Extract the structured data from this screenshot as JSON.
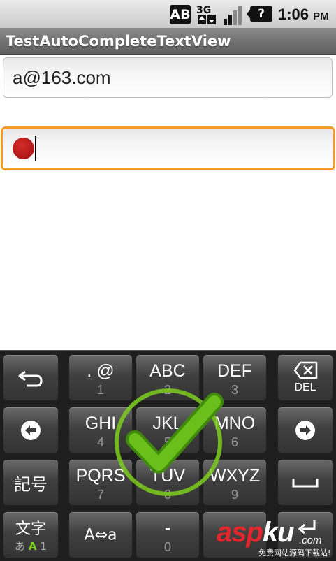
{
  "status_bar": {
    "ab_label": "AB",
    "network_label": "3G",
    "question_label": "?",
    "time": "1:06",
    "ampm": "PM"
  },
  "app": {
    "title": "TestAutoCompleteTextView"
  },
  "fields": {
    "email_value": "a@163.com",
    "focused_value": ""
  },
  "keyboard": {
    "back": {
      "icon": "return-arrow-icon"
    },
    "k1": {
      "main": ". @",
      "sub": "1"
    },
    "k2": {
      "main": "ABC",
      "sub": "2"
    },
    "k3": {
      "main": "DEF",
      "sub": "3"
    },
    "del": {
      "label": "DEL",
      "icon": "backspace-icon"
    },
    "left": {
      "icon": "left-arrow-circle-icon"
    },
    "k4": {
      "main": "GHI",
      "sub": "4"
    },
    "k5": {
      "main": "JKL",
      "sub": "5"
    },
    "k6": {
      "main": "MNO",
      "sub": "6"
    },
    "right": {
      "icon": "right-arrow-circle-icon"
    },
    "symbol": {
      "main": "記号"
    },
    "k7": {
      "main": "PQRS",
      "sub": "7"
    },
    "k8": {
      "main": "TUV",
      "sub": "8"
    },
    "k9": {
      "main": "WXYZ",
      "sub": "9"
    },
    "space": {
      "icon": "space-icon"
    },
    "mode": {
      "main": "文字",
      "sub_a": "あ",
      "sub_b": "A",
      "sub_c": "1"
    },
    "case": {
      "main": "A⇔a"
    },
    "k0": {
      "main": "-",
      "sub": "0"
    },
    "enter": {
      "icon": "enter-icon"
    }
  },
  "overlay": {
    "icon": "checkmark-icon"
  },
  "watermark": {
    "brand_red": "asp",
    "brand_white": "ku",
    "domain": ".com",
    "tagline": "免费网站源码下载站!"
  },
  "colors": {
    "focus_border": "#f39b28",
    "title_bar": "#6b6b6b",
    "check_green": "#6bbf1a",
    "watermark_red": "#e3262c"
  }
}
